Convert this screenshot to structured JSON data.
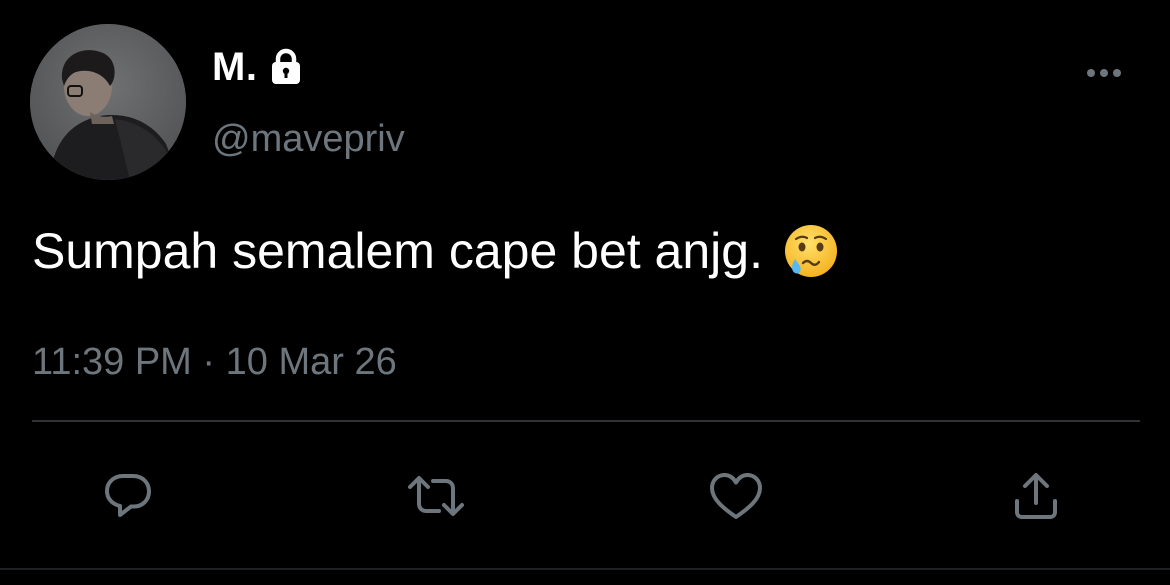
{
  "tweet": {
    "display_name": "M.",
    "handle": "@mavepriv",
    "protected": true,
    "text": "Sumpah semalem cape bet anjg.",
    "emoji": "face-holding-back-tears",
    "time": "11:39 PM",
    "separator": "·",
    "date": "10 Mar 26"
  },
  "icons": {
    "lock": "lock-icon",
    "more": "more-horizontal-icon",
    "reply": "reply-icon",
    "retweet": "retweet-icon",
    "like": "heart-icon",
    "share": "share-icon"
  },
  "colors": {
    "background": "#000000",
    "primary_text": "#ffffff",
    "secondary_text": "#6e767d",
    "divider": "#2f3336"
  }
}
